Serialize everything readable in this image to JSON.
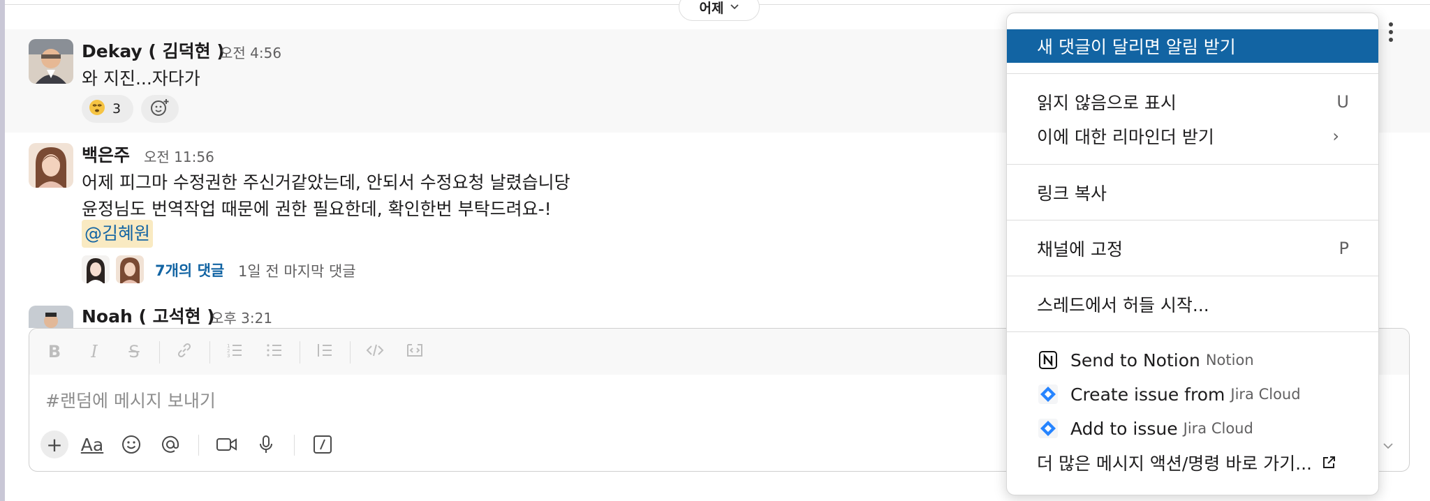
{
  "date_divider": {
    "label": "어제"
  },
  "messages": [
    {
      "sender": "Dekay ( 김덕현 )",
      "time": "오전 4:56",
      "lines": [
        "와 지진...자다가"
      ],
      "reactions": [
        {
          "emoji": "dizzy-face-emoji",
          "count": "3"
        }
      ]
    },
    {
      "sender": "백은주",
      "time": "오전 11:56",
      "lines": [
        "어제 피그마 수정권한 주신거같았는데, 안되서 수정요청 날렸습니당",
        "윤정님도 번역작업 때문에 권한 필요한데, 확인한번 부탁드려요-!"
      ],
      "mention": "@김혜원",
      "thread": {
        "count_label": "7개의 댓글",
        "last_reply": "1일 전 마지막 댓글"
      }
    },
    {
      "sender": "Noah ( 고석현 )",
      "time": "오후 3:21"
    }
  ],
  "composer": {
    "placeholder": "#랜덤에 메시지 보내기",
    "format_tools": [
      "bold-icon",
      "italic-icon",
      "strikethrough-icon",
      "link-icon",
      "ordered-list-icon",
      "bulleted-list-icon",
      "blockquote-icon",
      "code-icon",
      "code-block-icon"
    ],
    "bottom_tools": [
      "plus-icon",
      "text-format-icon",
      "emoji-icon",
      "mention-icon",
      "video-icon",
      "microphone-icon",
      "slash-command-icon"
    ]
  },
  "context_menu": {
    "follow_thread": "새 댓글이 달리면 알림 받기",
    "mark_unread": {
      "label": "읽지 않음으로 표시",
      "shortcut": "U"
    },
    "remind_me": {
      "label": "이에 대한 리마인더 받기",
      "arrow": "›"
    },
    "copy_link": "링크 복사",
    "pin_to_channel": {
      "label": "채널에 고정",
      "shortcut": "P"
    },
    "start_huddle": "스레드에서 허들 시작...",
    "apps": [
      {
        "label": "Send to Notion",
        "app": "Notion",
        "icon": "notion-icon"
      },
      {
        "label": "Create issue from",
        "app": "Jira Cloud",
        "icon": "jira-icon"
      },
      {
        "label": "Add to issue",
        "app": "Jira Cloud",
        "icon": "jira-icon"
      }
    ],
    "more_actions": "더 많은 메시지 액션/명령 바로 가기..."
  },
  "colors": {
    "accent": "#1264a3",
    "mention_bg": "#f9eac2",
    "jira_blue": "#2684ff"
  }
}
